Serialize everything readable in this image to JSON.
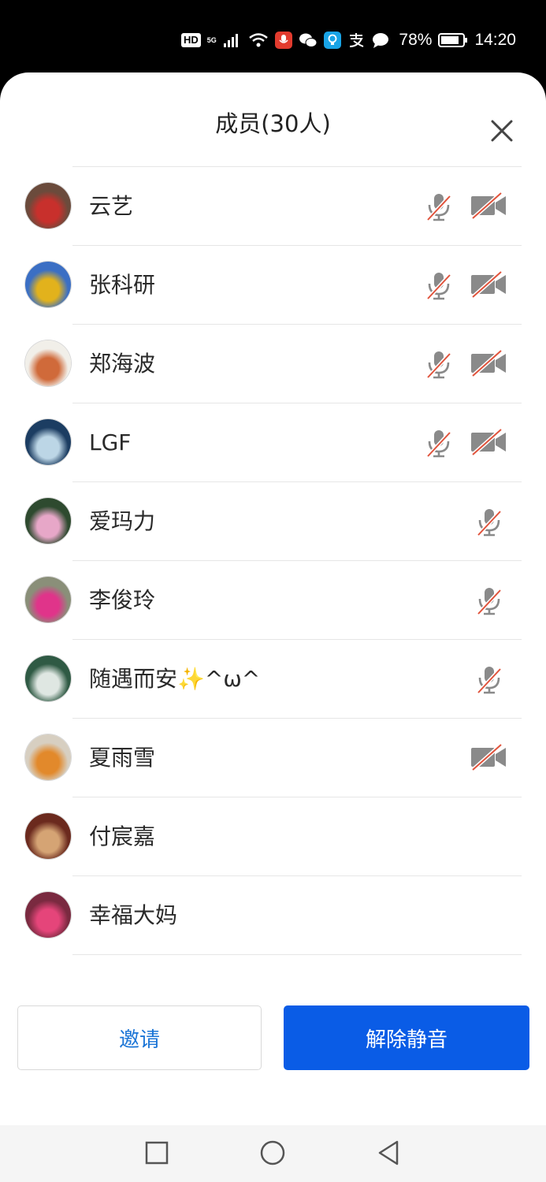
{
  "status_bar": {
    "hd": "HD",
    "network": "5G",
    "battery": "78%",
    "time": "14:20"
  },
  "panel": {
    "title": "成员(30人)"
  },
  "members": [
    {
      "name": "云艺",
      "mic_muted": true,
      "camera_off": true,
      "avatar_colors": [
        "#6b4b3c",
        "#c8302c"
      ]
    },
    {
      "name": "张科研",
      "mic_muted": true,
      "camera_off": true,
      "avatar_colors": [
        "#3b6fc4",
        "#e2b21c"
      ]
    },
    {
      "name": "郑海波",
      "mic_muted": true,
      "camera_off": true,
      "avatar_colors": [
        "#f1efe9",
        "#d06a3a"
      ]
    },
    {
      "name": "LGF",
      "mic_muted": true,
      "camera_off": true,
      "avatar_colors": [
        "#1c3d62",
        "#bcd6e6"
      ]
    },
    {
      "name": "爱玛力",
      "mic_muted": true,
      "camera_off": false,
      "avatar_colors": [
        "#2e4a2f",
        "#e7a7c8"
      ]
    },
    {
      "name": "李俊玲",
      "mic_muted": true,
      "camera_off": false,
      "avatar_colors": [
        "#8a8f79",
        "#e0348a"
      ]
    },
    {
      "name": "随遇而安✨^ω^",
      "mic_muted": true,
      "camera_off": false,
      "avatar_colors": [
        "#2f5a44",
        "#dfe7e2"
      ]
    },
    {
      "name": "夏雨雪",
      "mic_muted": false,
      "camera_off": true,
      "avatar_colors": [
        "#d7cfc1",
        "#e2892b"
      ]
    },
    {
      "name": "付宸嘉",
      "mic_muted": false,
      "camera_off": false,
      "avatar_colors": [
        "#6b2a1e",
        "#d5a474"
      ]
    },
    {
      "name": "幸福大妈",
      "mic_muted": false,
      "camera_off": false,
      "avatar_colors": [
        "#7a2a40",
        "#e5457a"
      ]
    }
  ],
  "actions": {
    "invite": "邀请",
    "unmute_all": "解除静音"
  },
  "colors": {
    "accent": "#0a5ce6",
    "link": "#1a74d6",
    "muted_slash": "#e0533c",
    "icon_gray": "#8a8a8a"
  }
}
